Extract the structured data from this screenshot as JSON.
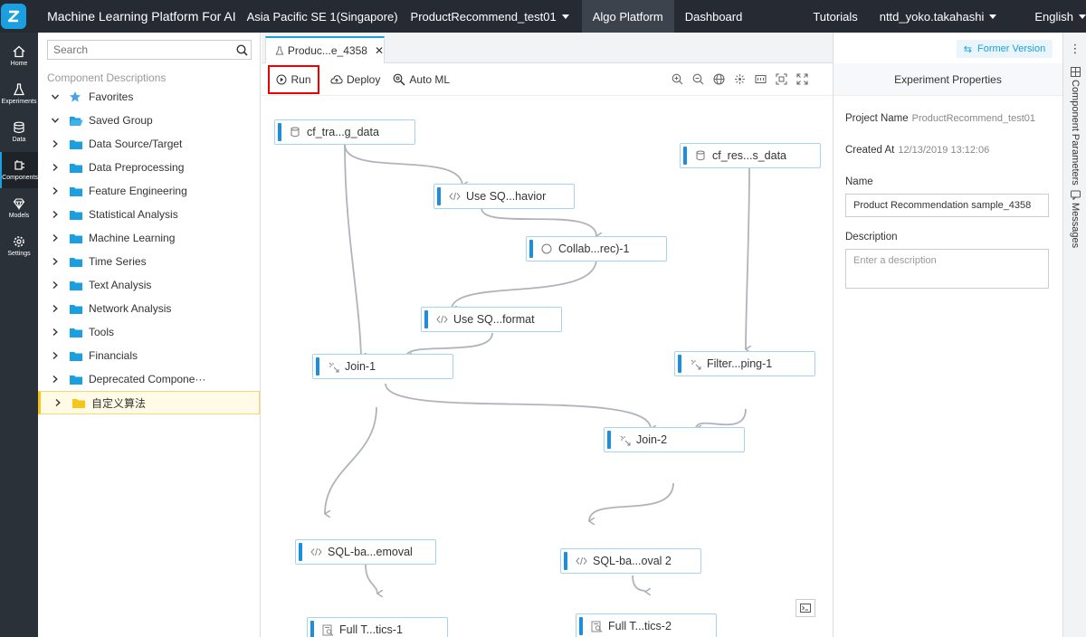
{
  "topbar": {
    "app_title": "Machine Learning Platform For AI",
    "region": "Asia Pacific SE 1(Singapore)",
    "project": "ProductRecommend_test01",
    "nav_algo": "Algo Platform",
    "nav_dashboard": "Dashboard",
    "tutorials": "Tutorials",
    "user": "nttd_yoko.takahashi",
    "language": "English"
  },
  "leftnav": {
    "items": [
      {
        "label": "Home",
        "icon": "home-icon"
      },
      {
        "label": "Experiments",
        "icon": "flask-icon"
      },
      {
        "label": "Data",
        "icon": "database-icon"
      },
      {
        "label": "Components",
        "icon": "component-icon"
      },
      {
        "label": "Models",
        "icon": "diamond-icon"
      },
      {
        "label": "Settings",
        "icon": "gear-icon"
      }
    ],
    "active_index": 3
  },
  "components": {
    "search_placeholder": "Search",
    "section_label": "Component Descriptions",
    "tree": [
      {
        "label": "Favorites",
        "icon": "star-icon",
        "expanded": true
      },
      {
        "label": "Saved Group",
        "icon": "folder-open-icon",
        "expanded": true
      },
      {
        "label": "Data Source/Target",
        "icon": "folder-icon"
      },
      {
        "label": "Data Preprocessing",
        "icon": "folder-icon"
      },
      {
        "label": "Feature Engineering",
        "icon": "folder-icon"
      },
      {
        "label": "Statistical Analysis",
        "icon": "folder-icon"
      },
      {
        "label": "Machine Learning",
        "icon": "folder-icon"
      },
      {
        "label": "Time Series",
        "icon": "folder-icon"
      },
      {
        "label": "Text Analysis",
        "icon": "folder-icon"
      },
      {
        "label": "Network Analysis",
        "icon": "folder-icon"
      },
      {
        "label": "Tools",
        "icon": "folder-icon"
      },
      {
        "label": "Financials",
        "icon": "folder-icon"
      },
      {
        "label": "Deprecated Compone···",
        "icon": "folder-icon"
      },
      {
        "label": "自定义算法",
        "icon": "folder-yellow-icon",
        "selected": true
      }
    ]
  },
  "editor": {
    "tab_label": "Produc...e_4358",
    "toolbar": {
      "run": "Run",
      "deploy": "Deploy",
      "auto_ml": "Auto ML"
    },
    "nodes": [
      {
        "id": "n1",
        "label": "cf_tra...g_data",
        "icon": "database-icon"
      },
      {
        "id": "n2",
        "label": "Use SQ...havior",
        "icon": "code-icon"
      },
      {
        "id": "n3",
        "label": "Collab...rec)-1",
        "icon": "circle-icon"
      },
      {
        "id": "n4",
        "label": "Use SQ...format",
        "icon": "code-icon"
      },
      {
        "id": "n5",
        "label": "Join-1",
        "icon": "join-icon"
      },
      {
        "id": "n6",
        "label": "cf_res...s_data",
        "icon": "database-icon"
      },
      {
        "id": "n7",
        "label": "Filter...ping-1",
        "icon": "join-icon"
      },
      {
        "id": "n8",
        "label": "Join-2",
        "icon": "join-icon"
      },
      {
        "id": "n9",
        "label": "SQL-ba...emoval",
        "icon": "code-icon"
      },
      {
        "id": "n10",
        "label": "SQL-ba...oval 2",
        "icon": "code-icon"
      },
      {
        "id": "n11",
        "label": "Full T...tics-1",
        "icon": "report-icon"
      },
      {
        "id": "n12",
        "label": "Full T...tics-2",
        "icon": "report-icon"
      }
    ]
  },
  "props": {
    "former_version": "Former Version",
    "header": "Experiment Properties",
    "project_name_label": "Project Name",
    "project_name_value": "ProductRecommend_test01",
    "created_at_label": "Created At",
    "created_at_value": "12/13/2019 13:12:06",
    "name_label": "Name",
    "name_value": "Product Recommendation sample_4358",
    "description_label": "Description",
    "description_placeholder": "Enter a description"
  },
  "sidetabs": {
    "component_parameters": "Component Parameters",
    "messages": "Messages"
  },
  "colors": {
    "topbar_bg": "#262b33",
    "accent": "#1aa0e0",
    "run_highlight": "#ee0000"
  }
}
